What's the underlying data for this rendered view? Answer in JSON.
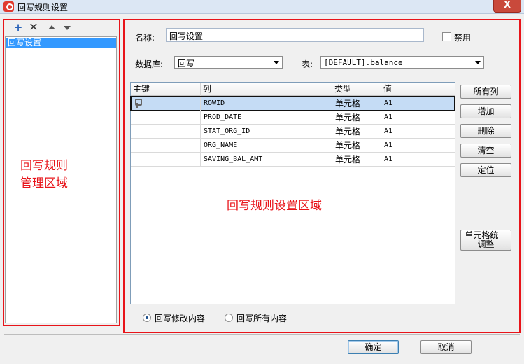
{
  "window": {
    "title": "回写规则设置",
    "close_label": "X"
  },
  "left_panel": {
    "annotation_line1": "回写规则",
    "annotation_line2": "管理区域",
    "rules": [
      "回写设置"
    ]
  },
  "right_panel": {
    "annotation": "回写规则设置区域",
    "name_label": "名称:",
    "name_value": "回写设置",
    "disable_label": "禁用",
    "database_label": "数据库:",
    "database_value": "回写",
    "table_label": "表:",
    "table_value": "[DEFAULT].balance",
    "grid": {
      "columns": [
        "主键",
        "列",
        "类型",
        "值"
      ],
      "rows": [
        {
          "key": true,
          "column": "ROWID",
          "type": "单元格",
          "value": "A1"
        },
        {
          "key": false,
          "column": "PROD_DATE",
          "type": "单元格",
          "value": "A1"
        },
        {
          "key": false,
          "column": "STAT_ORG_ID",
          "type": "单元格",
          "value": "A1"
        },
        {
          "key": false,
          "column": "ORG_NAME",
          "type": "单元格",
          "value": "A1"
        },
        {
          "key": false,
          "column": "SAVING_BAL_AMT",
          "type": "单元格",
          "value": "A1"
        }
      ]
    },
    "side_buttons": {
      "all_columns": "所有列",
      "add": "增加",
      "delete": "删除",
      "clear": "清空",
      "locate": "定位",
      "unify_line1": "单元格统一",
      "unify_line2": "调整"
    },
    "write_mode": {
      "modified": "回写修改内容",
      "all": "回写所有内容",
      "selected": "modified"
    }
  },
  "footer": {
    "ok": "确定",
    "cancel": "取消"
  }
}
